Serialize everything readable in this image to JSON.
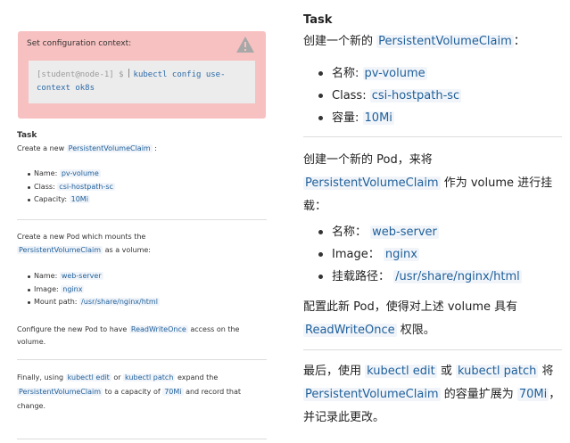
{
  "alert": {
    "title": "Set configuration context:",
    "prompt": "[student@node-1] $",
    "command": "kubectl config use-context ok8s"
  },
  "left": {
    "task_heading": "Task",
    "pvc_intro": "Create a new",
    "pvc_term": "PersistentVolumeClaim",
    "pvc_end": ":",
    "pvc_items": [
      {
        "label": "Name:",
        "value": "pv-volume"
      },
      {
        "label": "Class:",
        "value": "csi-hostpath-sc"
      },
      {
        "label": "Capacity:",
        "value": "10Mi"
      }
    ],
    "pod_intro_line1": "Create a new Pod which mounts the",
    "pod_term": "PersistentVolumeClaim",
    "pod_intro_end": "as a volume:",
    "pod_items": [
      {
        "label": "Name:",
        "value": "web-server"
      },
      {
        "label": "Image:",
        "value": "nginx"
      },
      {
        "label": "Mount path:",
        "value": "/usr/share/nginx/html"
      }
    ],
    "config_start": "Configure the new Pod to have",
    "config_term": "ReadWriteOnce",
    "config_end": "access on the volume.",
    "final_start": "Finally, using",
    "final_cmd1": "kubectl edit",
    "final_or": "or",
    "final_cmd2": "kubectl patch",
    "final_mid": "expand the",
    "final_term": "PersistentVolumeClaim",
    "final_to": "to a capacity of",
    "final_cap": "70Mi",
    "final_end": "and record that change."
  },
  "right": {
    "task_heading": "Task",
    "pvc_intro": "创建一个新的",
    "pvc_term": "PersistentVolumeClaim",
    "pvc_end": "：",
    "pvc_items": [
      {
        "label": "名称:",
        "value": "pv-volume"
      },
      {
        "label": "Class:",
        "value": "csi-hostpath-sc"
      },
      {
        "label": "容量:",
        "value": "10Mi"
      }
    ],
    "pod_intro_line1": "创建一个新的 Pod，来将",
    "pod_term": "PersistentVolumeClaim",
    "pod_intro_mid": "作为 volume 进行挂",
    "pod_intro_line3": "载：",
    "pod_items": [
      {
        "label": "名称：",
        "value": "web-server"
      },
      {
        "label": "Image：",
        "value": "nginx"
      },
      {
        "label": "挂载路径：",
        "value": "/usr/share/nginx/html"
      }
    ],
    "config_start": "配置此新 Pod，使得对上述 volume 具有",
    "config_term": "ReadWriteOnce",
    "config_end": "权限。",
    "final_start": "最后，使用",
    "final_cmd1": "kubectl edit",
    "final_or": "或",
    "final_cmd2": "kubectl patch",
    "final_mid": "将",
    "final_term": "PersistentVolumeClaim",
    "final_to": "的容量扩展为",
    "final_cap": "70Mi",
    "final_end": "，并记录此更改。"
  }
}
